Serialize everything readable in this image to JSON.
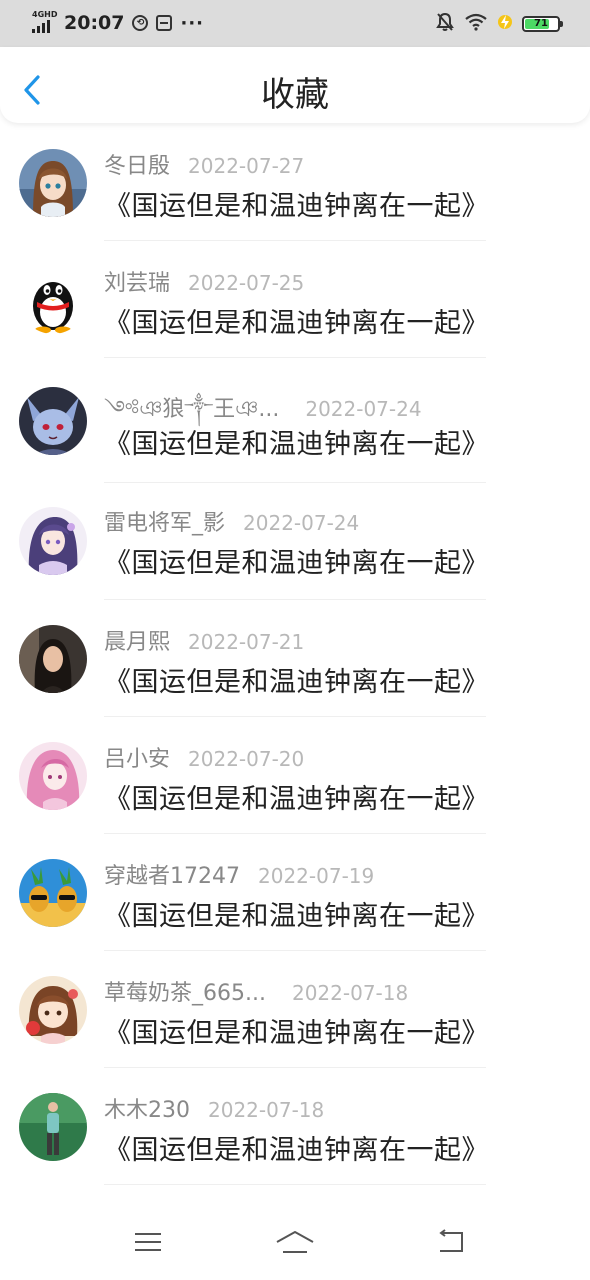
{
  "status_bar": {
    "network": "4GHD",
    "time": "20:07",
    "battery": "71",
    "icons": [
      "signal-icon",
      "data-saver-icon",
      "sim-card-icon",
      "more-icon",
      "mute-bell-icon",
      "wifi-icon",
      "charging-icon",
      "battery-icon"
    ]
  },
  "header": {
    "title": "收藏",
    "back_icon": "chevron-left-icon"
  },
  "colors": {
    "accent": "#1f95e8",
    "name": "#888888",
    "date": "#b8b8b8",
    "title": "#222222"
  },
  "favorites": [
    {
      "user": "冬日殷",
      "date": "2022-07-27",
      "title": "《国运但是和温迪钟离在一起》",
      "avatar": "anime-girl-avatar"
    },
    {
      "user": "刘芸瑞",
      "date": "2022-07-25",
      "title": "《国运但是和温迪钟离在一起》",
      "avatar": "qq-penguin-avatar"
    },
    {
      "user": "༺ঞ狼༒王ঞ...",
      "date": "2022-07-24",
      "title": "《国运但是和温迪钟离在一起》",
      "avatar": "anime-creature-avatar"
    },
    {
      "user": "雷电将军_影",
      "date": "2022-07-24",
      "title": "《国运但是和温迪钟离在一起》",
      "avatar": "anime-girl-purple-avatar"
    },
    {
      "user": "晨月熙",
      "date": "2022-07-21",
      "title": "《国运但是和温迪钟离在一起》",
      "avatar": "photo-girl-avatar"
    },
    {
      "user": "吕小安",
      "date": "2022-07-20",
      "title": "《国运但是和温迪钟离在一起》",
      "avatar": "anime-pink-avatar"
    },
    {
      "user": "穿越者17247",
      "date": "2022-07-19",
      "title": "《国运但是和温迪钟离在一起》",
      "avatar": "pineapple-avatar"
    },
    {
      "user": "草莓奶茶_665...",
      "date": "2022-07-18",
      "title": "《国运但是和温迪钟离在一起》",
      "avatar": "anime-chibi-avatar"
    },
    {
      "user": "木木230",
      "date": "2022-07-18",
      "title": "《国运但是和温迪钟离在一起》",
      "avatar": "photo-boy-avatar"
    }
  ],
  "nav": [
    "menu-icon",
    "home-icon",
    "back-icon"
  ]
}
